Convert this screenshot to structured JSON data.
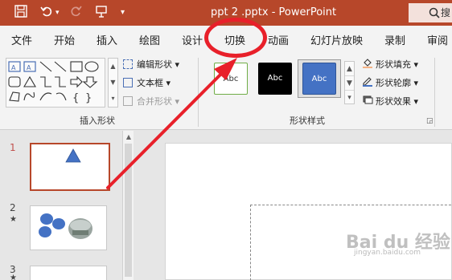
{
  "titlebar": {
    "title": "ppt 2 .pptx  -  PowerPoint",
    "search_label": "搜",
    "bg_color": "#b7472a"
  },
  "tabs": [
    "文件",
    "开始",
    "插入",
    "绘图",
    "设计",
    "切换",
    "动画",
    "幻灯片放映",
    "录制",
    "审阅"
  ],
  "ribbon": {
    "insert_shapes": {
      "label": "插入形状",
      "edit_shape": "编辑形状",
      "text_box": "文本框",
      "merge_shapes": "合并形状"
    },
    "shape_styles": {
      "label": "形状样式",
      "presets": [
        "Abc",
        "Abc",
        "Abc"
      ],
      "shape_fill": "形状填充",
      "shape_outline": "形状轮廓",
      "shape_effects": "形状效果"
    }
  },
  "slides": {
    "numbers": [
      "1",
      "2",
      "3"
    ],
    "star": "★"
  },
  "watermark": {
    "brand": "Bai du 经验",
    "url": "jingyan.baidu.com"
  },
  "annotation_color": "#e8202a"
}
